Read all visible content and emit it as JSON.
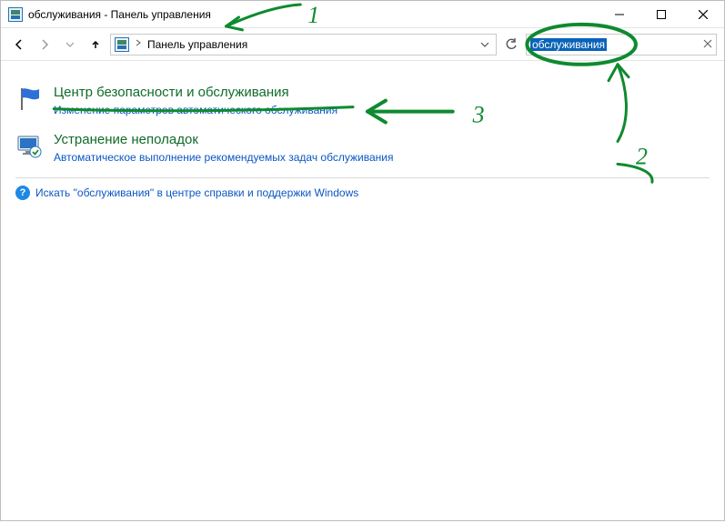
{
  "window": {
    "title": "обслуживания - Панель управления"
  },
  "toolbar": {
    "breadcrumb_root": "Панель управления",
    "search_value": "обслуживания"
  },
  "results": [
    {
      "title": "Центр безопасности и обслуживания",
      "sub": "Изменение параметров автоматического обслуживания"
    },
    {
      "title": "Устранение неполадок",
      "sub": "Автоматическое выполнение рекомендуемых задач обслуживания"
    }
  ],
  "help_line": "Искать \"обслуживания\" в центре справки и поддержки Windows",
  "annotations": {
    "n1": "1",
    "n2": "2",
    "n3": "3"
  }
}
